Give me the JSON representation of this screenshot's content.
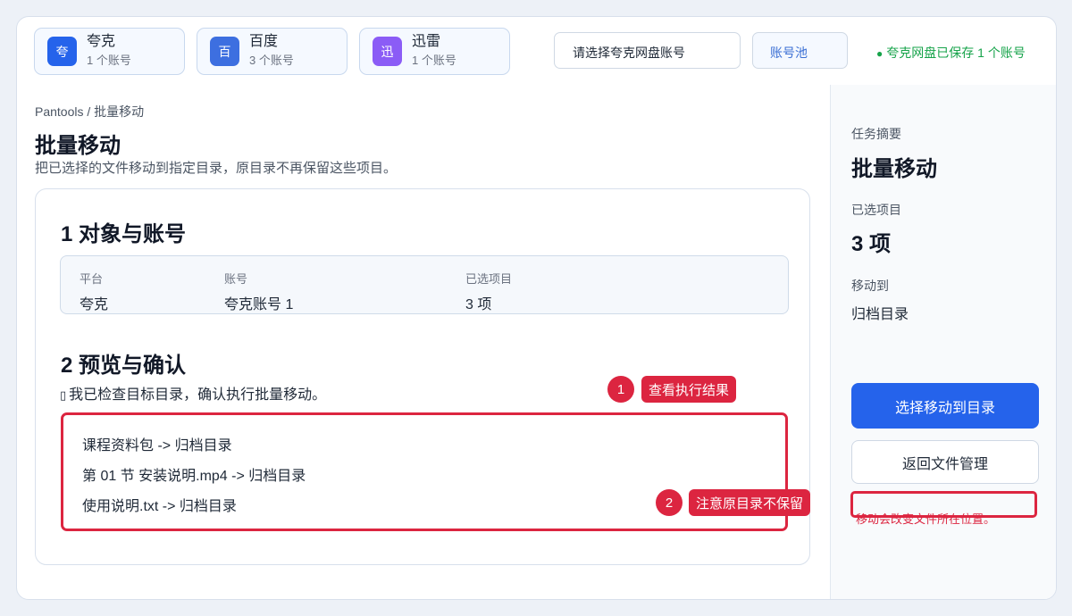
{
  "platforms": [
    {
      "icon_char": "夸",
      "name": "夸克",
      "count": "1 个账号",
      "color": "#2563eb"
    },
    {
      "icon_char": "百",
      "name": "百度",
      "count": "3 个账号",
      "color": "#3d6fe0"
    },
    {
      "icon_char": "迅",
      "name": "迅雷",
      "count": "1 个账号",
      "color": "#8b5cf6"
    }
  ],
  "header": {
    "account_select_value": "请选择夸克网盘账号",
    "pool_button": "账号池",
    "saved_status": "夸克网盘已保存 1 个账号",
    "status_dot": "●"
  },
  "main": {
    "breadcrumb": "Pantools / 批量移动",
    "title": "批量移动",
    "description": "把已选择的文件移动到指定目录，原目录不再保留这些项目。",
    "section1_title": "1  对象与账号",
    "info": {
      "platform_label": "平台",
      "platform_value": "夸克",
      "account_label": "账号",
      "account_value": "夸克账号 1",
      "selected_label": "已选项目",
      "selected_value": "3 项"
    },
    "section2_title": "2  预览与确认",
    "checkbox_glyph": "▯",
    "confirm_text": "我已检查目标目录，确认执行批量移动。",
    "preview_items": [
      "课程资料包 -> 归档目录",
      "第 01 节 安装说明.mp4 -> 归档目录",
      "使用说明.txt -> 归档目录"
    ]
  },
  "sidebar": {
    "summary_label": "任务摘要",
    "task_title": "批量移动",
    "selected_label": "已选项目",
    "selected_count": "3 项",
    "move_to_label": "移动到",
    "move_to_value": "归档目录",
    "primary_button": "选择移动到目录",
    "secondary_button": "返回文件管理",
    "warning": "移动会改变文件所在位置。"
  },
  "annotations": [
    {
      "number": "1",
      "label": "查看执行结果"
    },
    {
      "number": "2",
      "label": "注意原目录不保留"
    }
  ],
  "colors": {
    "accent": "#2563eb",
    "annotation_red": "#dc2540",
    "success_green": "#16a34a"
  }
}
